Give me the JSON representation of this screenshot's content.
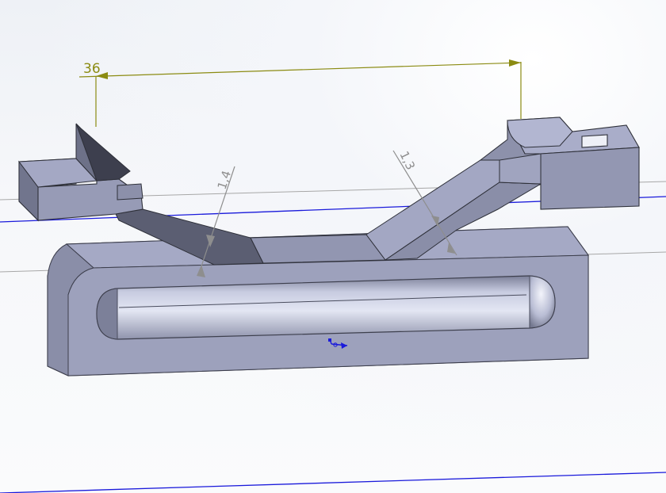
{
  "colors": {
    "dimension_primary": "#8b8b12",
    "dimension_secondary": "#8e8e8e",
    "sketch_line": "#1a1adb",
    "construction_line": "#9a9a9a",
    "part_face_light": "#a9adc9",
    "part_face_mid": "#8d91ab",
    "part_face_dark": "#55586c",
    "slot_highlight": "#dfe2f2"
  },
  "dimensions": {
    "main_length": "36",
    "thickness_left": "1,4",
    "thickness_right": "1,3"
  },
  "icons": {
    "origin": "origin-icon"
  }
}
